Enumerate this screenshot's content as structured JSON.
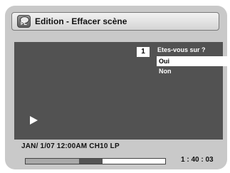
{
  "header": {
    "icon_label": "PL",
    "title": "Edition - Effacer scène"
  },
  "video": {
    "scene_number": "1",
    "play_state_icon": "play-icon"
  },
  "confirm_dialog": {
    "question": "Etes-vous sur ?",
    "options": [
      {
        "label": "Oui",
        "selected": true
      },
      {
        "label": "Non",
        "selected": false
      }
    ]
  },
  "status": {
    "info": "JAN/ 1/07 12:00AM CH10   LP",
    "time": "1 : 40 : 03",
    "progress_fraction": 0.55,
    "colors": {
      "background": "#c9c9c9",
      "video": "#525252",
      "selection": "#ffffff"
    }
  }
}
